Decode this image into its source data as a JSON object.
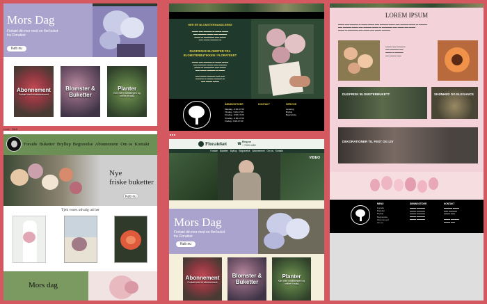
{
  "panel1": {
    "hero_title": "Mors Dag",
    "hero_sub": "Forkæl din mor med en flot buket fra Floraktet",
    "hero_button": "Køb nu",
    "tiles": [
      {
        "title": "Abonnement",
        "sub": "Forkæl med et abonnement"
      },
      {
        "title": "Blomster & Buketter",
        "sub": ""
      },
      {
        "title": "Planter",
        "sub": "Køn hæl i butikkingen og online til salg"
      }
    ]
  },
  "panel2": {
    "label": "Lock · Slett",
    "nav": [
      "Forside",
      "Buketter",
      "Bryllup",
      "Begravelse",
      "Abonnement",
      "Om os",
      "Kontakt"
    ],
    "hero_title_l1": "Nye",
    "hero_title_l2": "friske buketter",
    "hero_button": "Køb nu",
    "section_title": "Tjek vores udvalg ud her",
    "bottom_title": "Mors dag"
  },
  "panel3": {
    "header_title": "HER ER BLOMSTERHANDLERNE",
    "heading2": "DUGFRISKE BLOMSTER FRA BLOMSTERBUTIKKEN I FLORATEKET",
    "footer_cols": [
      "ÅBNINGSTIDER",
      "KONTAKT",
      "SERVICE"
    ],
    "hours": [
      "Mandag - 9:00-17:00",
      "Tirsdag - 9:00-17:00",
      "Onsdag - 9:00-17:00",
      "Torsdag - 9:00-17:00",
      "Fredag - 9:00-17:00"
    ],
    "service": [
      "Levering",
      "Bryllup",
      "Begravelse"
    ]
  },
  "panel4": {
    "brand": "Florateket",
    "phone_label": "Ring os",
    "phone": "+ 7099 4480",
    "nav": [
      "Forside",
      "Buketter",
      "Bryllup",
      "Begravelse",
      "Abonnement",
      "Om os",
      "Kontakt"
    ],
    "video_label": "VIDEO",
    "hero_title": "Mors Dag",
    "hero_sub": "Forkæl din mor med en flot buket fra Floraktet",
    "hero_button": "Køb nu",
    "tiles": [
      {
        "title": "Abonnement",
        "sub": "Forkæl med et abonnement"
      },
      {
        "title": "Blomster & Buketter",
        "sub": ""
      },
      {
        "title": "Planter",
        "sub": "Køn hæl i butikkingen og online til salg"
      }
    ]
  },
  "panel5": {
    "title": "LOREM IPSUM",
    "cards": [
      "DUGFRISK BLOMSTERBUKETT",
      "SKØNHED OG ELEGANCE",
      "DEKORATIONER TIL FEST OG LIV"
    ],
    "footer_cols": [
      "MENU",
      "ÅBNINGSTIDER",
      "KONTAKT"
    ],
    "menu": [
      "Forside",
      "Buketter",
      "Bryllup",
      "Begravelse",
      "Abonnement",
      "Om os"
    ]
  },
  "colors": {
    "frame": "#d4585f",
    "lavender": "#aaa3cd",
    "dark_green": "#1f3a2c",
    "nav_green": "#6b8f54",
    "pink": "#f3d3d9"
  }
}
